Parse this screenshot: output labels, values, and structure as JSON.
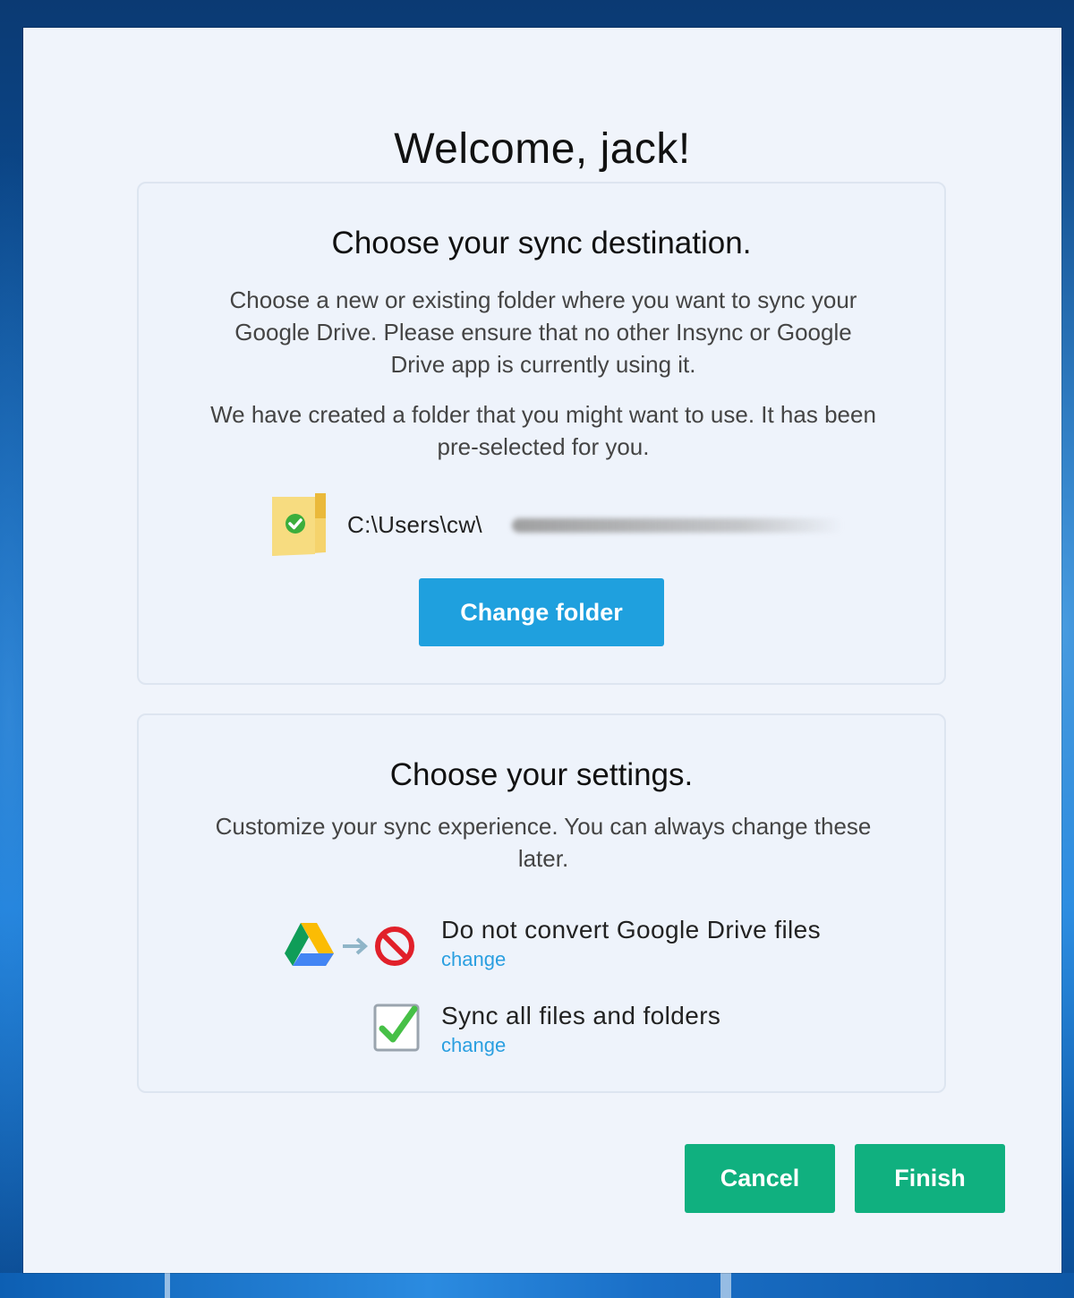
{
  "window": {
    "welcome_title": "Welcome, jack!"
  },
  "destination": {
    "heading": "Choose your sync destination.",
    "description": "Choose a new or existing folder where you want to sync your Google Drive. Please ensure that no other Insync or Google Drive app is currently using it.",
    "note": "We have created a folder that you might want to use. It has been pre-selected for you.",
    "folder_path": "C:\\Users\\cw\\",
    "change_folder_label": "Change folder"
  },
  "settings": {
    "heading": "Choose your settings.",
    "description": "Customize your sync experience. You can always change these later.",
    "items": [
      {
        "label": "Do not convert Google Drive files",
        "link": "change",
        "icon": "no-convert-icon"
      },
      {
        "label": "Sync all files and folders",
        "link": "change",
        "icon": "checkbox-checked-icon"
      }
    ]
  },
  "footer": {
    "cancel_label": "Cancel",
    "finish_label": "Finish"
  },
  "colors": {
    "primary_button": "#1fa0de",
    "confirm_button": "#10b07f",
    "link": "#2a9fe0",
    "dialog_bg": "#f0f4fb"
  }
}
